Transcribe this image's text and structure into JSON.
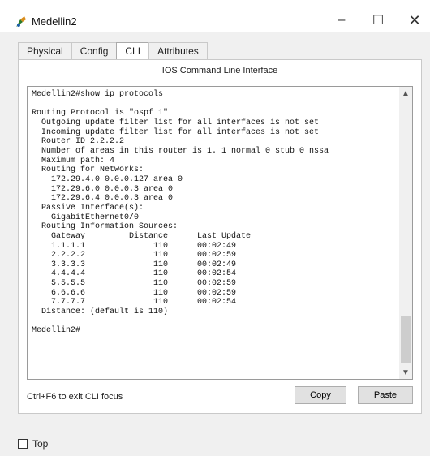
{
  "window": {
    "title": "Medellin2",
    "minimize": "–",
    "maximize": "☐",
    "close": "✕",
    "icon": "packet-tracer-device-icon"
  },
  "tabs": [
    "Physical",
    "Config",
    "CLI",
    "Attributes"
  ],
  "active_tab": "CLI",
  "cli": {
    "header": "IOS Command Line Interface",
    "lines": [
      "Medellin2#show ip protocols",
      "",
      "Routing Protocol is \"ospf 1\"",
      "  Outgoing update filter list for all interfaces is not set",
      "  Incoming update filter list for all interfaces is not set",
      "  Router ID 2.2.2.2",
      "  Number of areas in this router is 1. 1 normal 0 stub 0 nssa",
      "  Maximum path: 4",
      "  Routing for Networks:",
      "    172.29.4.0 0.0.0.127 area 0",
      "    172.29.6.0 0.0.0.3 area 0",
      "    172.29.6.4 0.0.0.3 area 0",
      "  Passive Interface(s):",
      "    GigabitEthernet0/0",
      "  Routing Information Sources:",
      "    Gateway         Distance      Last Update",
      "    1.1.1.1              110      00:02:49",
      "    2.2.2.2              110      00:02:59",
      "    3.3.3.3              110      00:02:49",
      "    4.4.4.4              110      00:02:54",
      "    5.5.5.5              110      00:02:59",
      "    6.6.6.6              110      00:02:59",
      "    7.7.7.7              110      00:02:54",
      "  Distance: (default is 110)",
      "",
      "Medellin2#"
    ]
  },
  "footer": {
    "hint": "Ctrl+F6 to exit CLI focus",
    "copy": "Copy",
    "paste": "Paste"
  },
  "top_checkbox": {
    "label": "Top",
    "checked": false
  }
}
